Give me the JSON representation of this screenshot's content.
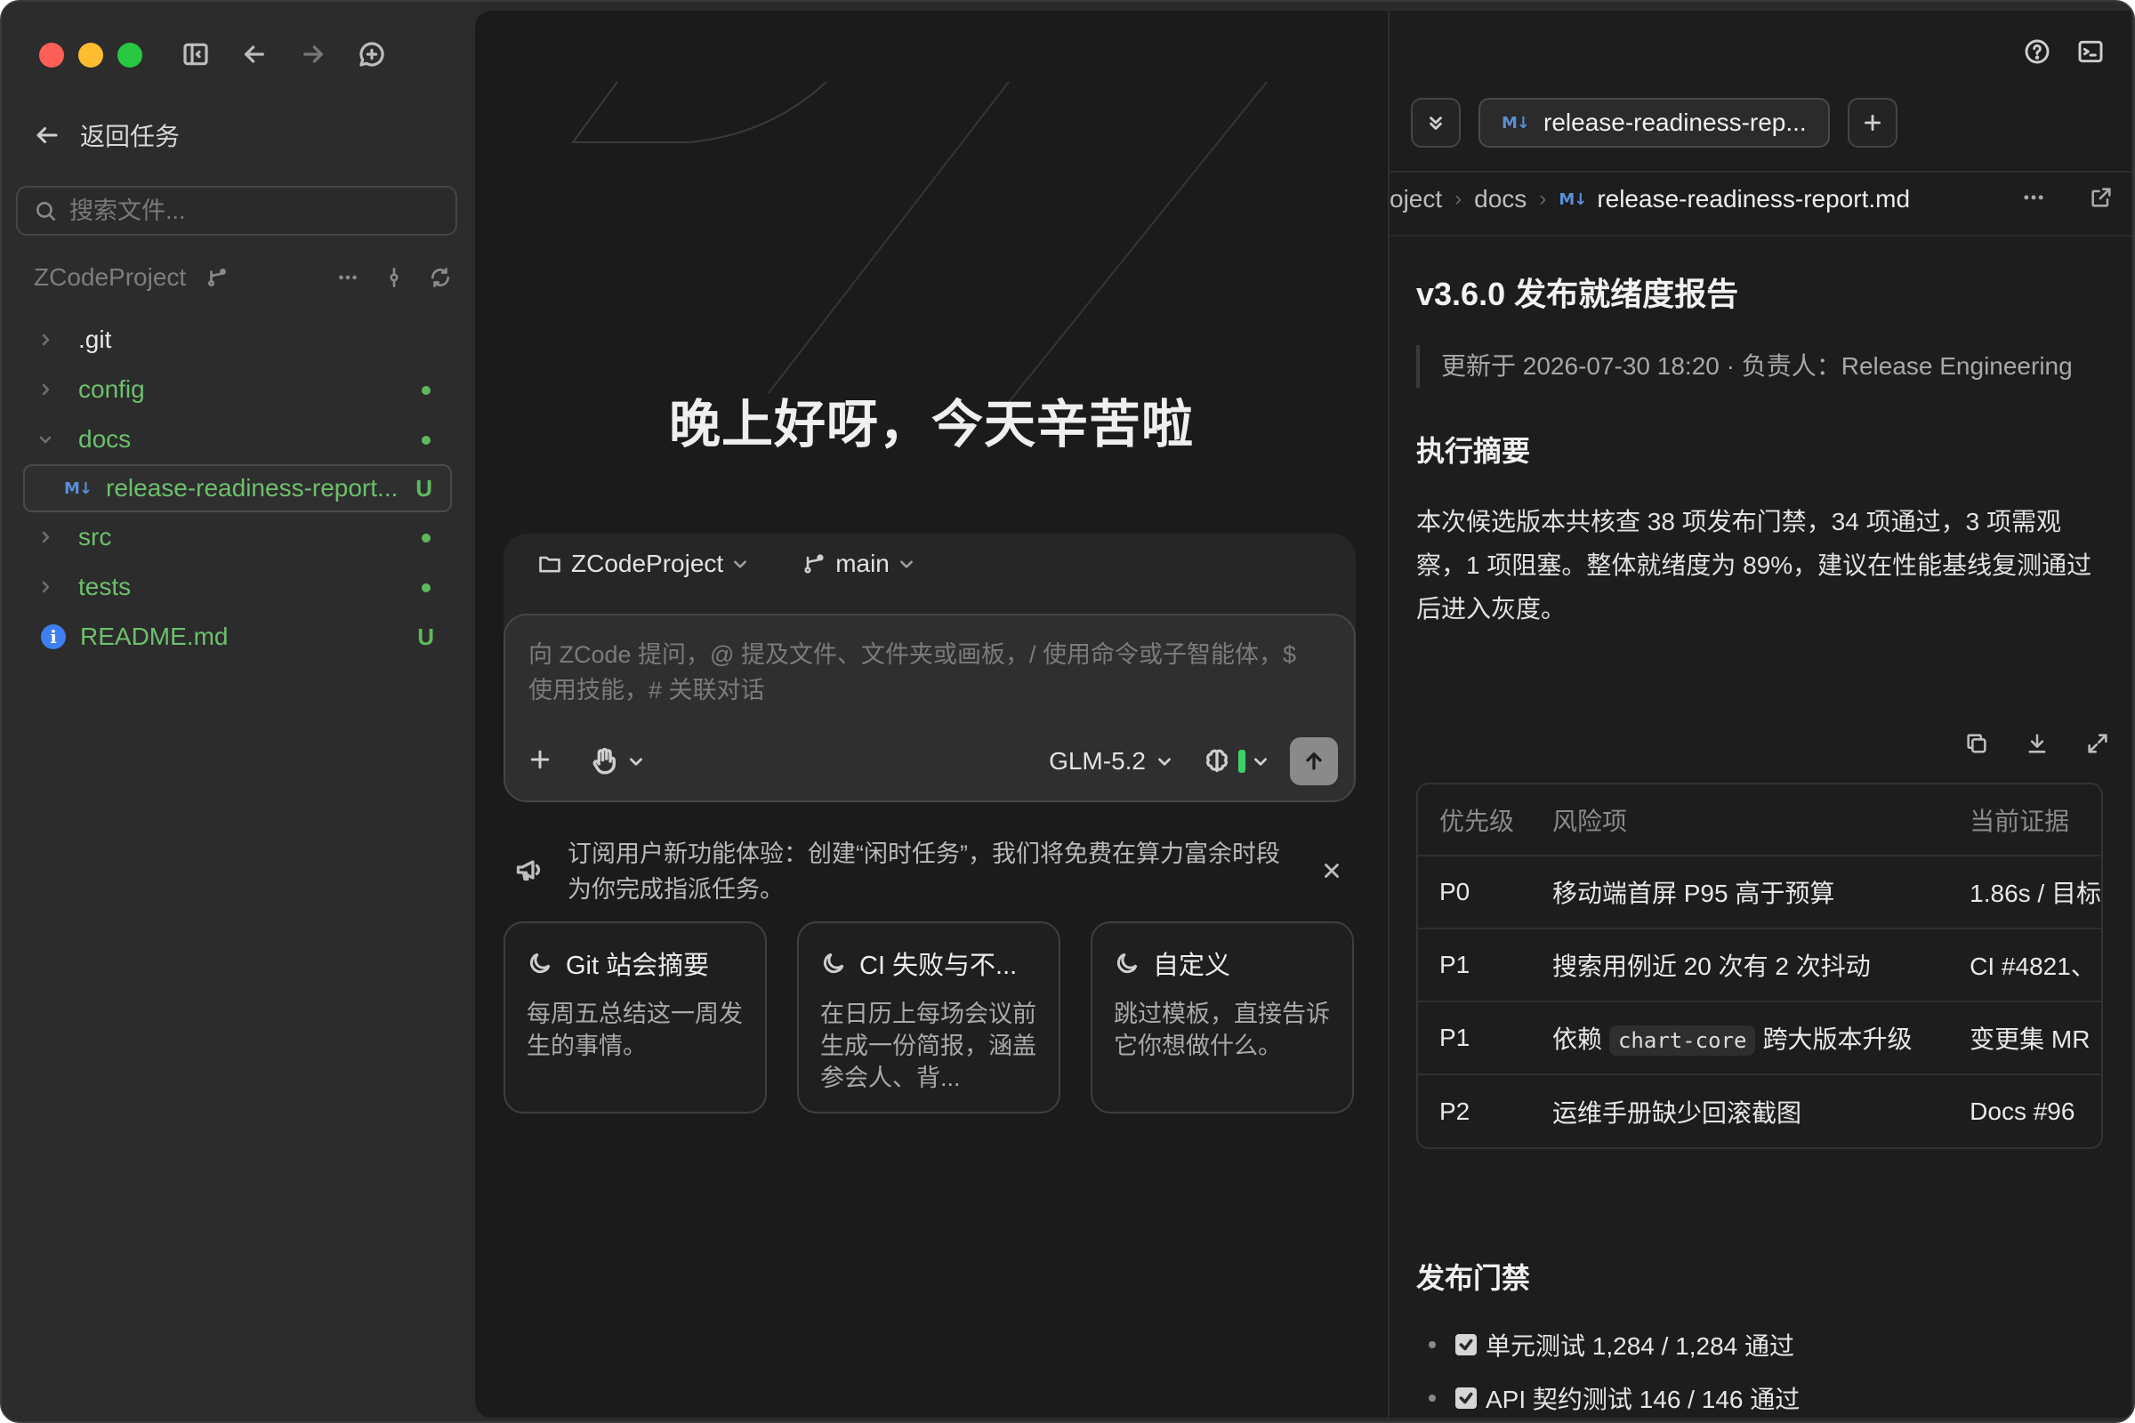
{
  "sidebar": {
    "back_label": "返回任务",
    "search_placeholder": "搜索文件...",
    "project_name": "ZCodeProject",
    "tree": [
      {
        "name": ".git",
        "state": "collapsed",
        "status": ""
      },
      {
        "name": "config",
        "state": "collapsed",
        "status": "modified"
      },
      {
        "name": "docs",
        "state": "expanded",
        "status": "modified"
      },
      {
        "name": "release-readiness-report...",
        "state": "file",
        "status": "U"
      },
      {
        "name": "src",
        "state": "collapsed",
        "status": "modified"
      },
      {
        "name": "tests",
        "state": "collapsed",
        "status": "modified"
      },
      {
        "name": "README.md",
        "state": "file",
        "status": "U"
      }
    ]
  },
  "center": {
    "greeting": "晚上好呀，今天辛苦啦",
    "project_selector": "ZCodeProject",
    "branch_selector": "main",
    "input_placeholder": "向 ZCode 提问，@ 提及文件、文件夹或画板，/ 使用命令或子智能体，$ 使用技能，# 关联对话",
    "model": "GLM-5.2",
    "notice": "订阅用户新功能体验：创建“闲时任务”，我们将免费在算力富余时段为你完成指派任务。",
    "cards": [
      {
        "title": "Git 站会摘要",
        "desc": "每周五总结这一周发生的事情。"
      },
      {
        "title": "CI 失败与不...",
        "desc": "在日历上每场会议前生成一份简报，涵盖参会人、背..."
      },
      {
        "title": "自定义",
        "desc": "跳过模板，直接告诉它你想做什么。"
      }
    ]
  },
  "right": {
    "tab_label": "release-readiness-rep...",
    "breadcrumb": [
      "oject",
      "docs",
      "release-readiness-report.md"
    ],
    "doc": {
      "title": "v3.6.0 发布就绪度报告",
      "meta": "更新于 2026-07-30 18:20 · 负责人：Release Engineering",
      "summary_heading": "执行摘要",
      "summary": "本次候选版本共核查 38 项发布门禁，34 项通过，3 项需观察，1 项阻塞。整体就绪度为 89%，建议在性能基线复测通过后进入灰度。",
      "table_headers": [
        "优先级",
        "风险项",
        "当前证据"
      ],
      "table_rows": [
        {
          "p": "P0",
          "risk": "移动端首屏 P95 高于预算",
          "evidence": "1.86s / 目标"
        },
        {
          "p": "P1",
          "risk": "搜索用例近 20 次有 2 次抖动",
          "evidence": "CI #4821、"
        },
        {
          "p": "P1",
          "risk_pre": "依赖",
          "risk_code": "chart-core",
          "risk_post": "跨大版本升级",
          "evidence": "变更集 MR"
        },
        {
          "p": "P2",
          "risk": "运维手册缺少回滚截图",
          "evidence": "Docs #96"
        }
      ],
      "gates_heading": "发布门禁",
      "gates": [
        {
          "text": "单元测试 1,284 / 1,284 通过",
          "checked": true
        },
        {
          "text": "API 契约测试 146 / 146 通过",
          "checked": true
        }
      ]
    }
  }
}
